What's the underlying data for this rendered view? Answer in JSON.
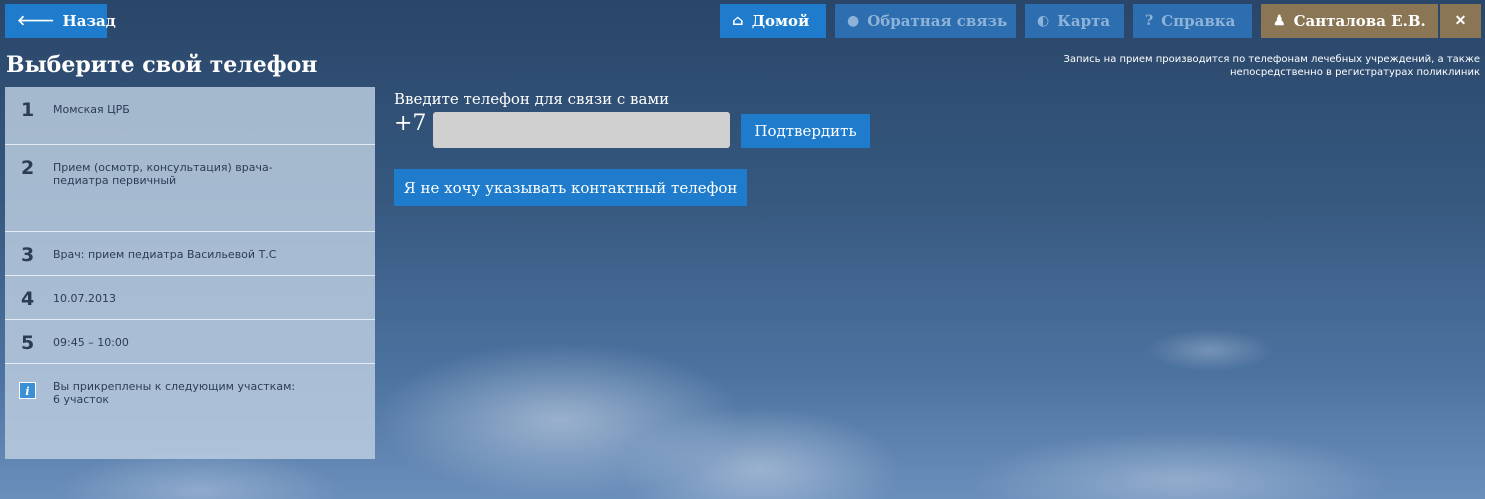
{
  "header": {
    "back_label": "Назад",
    "home_label": "Домой",
    "feedback_label": "Обратная связь",
    "map_label": "Карта",
    "help_label": "Справка",
    "user_label": "Санталова Е.В.",
    "close_label": "✕"
  },
  "page": {
    "title": "Выберите свой телефон",
    "notice": "Запись на прием производится по телефонам лечебных учреждений, а также непосредственно в регистратурах поликлиник"
  },
  "steps": [
    {
      "num": "1",
      "text": "Момская ЦРБ"
    },
    {
      "num": "2",
      "text": "Прием (осмотр, консультация) врача-педиатра первичный"
    },
    {
      "num": "3",
      "text": "Врач: прием педиатра Васильевой Т.С"
    },
    {
      "num": "4",
      "text": "10.07.2013"
    },
    {
      "num": "5",
      "text": "09:45 – 10:00"
    }
  ],
  "info": {
    "text": "Вы прикреплены к следующим участкам:",
    "value": "6 участок"
  },
  "form": {
    "label": "Введите телефон для связи с вами",
    "prefix": "+7",
    "phone_value": "",
    "confirm_label": "Подтвердить",
    "decline_label": "Я не хочу указывать контактный телефон"
  },
  "colors": {
    "accent": "#1f7ccc",
    "user_button": "#8a7654",
    "input_bg": "#d0d0d0"
  }
}
